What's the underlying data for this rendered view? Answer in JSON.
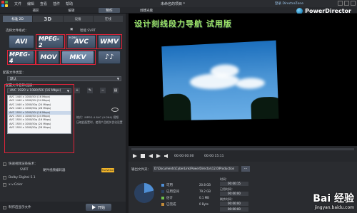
{
  "titlebar": {
    "menus": [
      "文件",
      "编辑",
      "查看",
      "插件",
      "帮助"
    ],
    "document_title": "未命名的项目 *",
    "login": "登录 DirectorZone"
  },
  "modebar": {
    "tabs": [
      "捕获",
      "编辑",
      "制作"
    ],
    "active_tab": "制作",
    "create_disc": "创建光盘",
    "brand": "PowerDirector"
  },
  "left_panel": {
    "sub_tabs": [
      "标准 2D",
      "3D",
      "设备",
      "在线"
    ],
    "format_section_label": "选择文件格式：",
    "smart_svrt_label": "智能 SVRT",
    "formats": [
      {
        "label": "AVI"
      },
      {
        "label": "MPEG-2"
      },
      {
        "label": "AVC",
        "sub": "H.264"
      },
      {
        "label": "WMV"
      },
      {
        "label": "MPEG-4"
      },
      {
        "label": "MOV"
      },
      {
        "label": "MKV",
        "selected": true
      },
      {
        "label": "♪♪"
      }
    ],
    "settings_label": "配置文件类型：",
    "type_value": "默认",
    "profile_label": "配置文件名称/品质：",
    "profile_value": "AVC 1920 x 1080/50i (16 Mbps)",
    "profile_options": [
      "AVC 1440 x 1080/50i (16 Mbps)",
      "AVC 1440 x 1080/50i (24 Mbps)",
      "AVC 1440 x 1080/50p (24 Mbps)",
      "AVC 1440 x 1080/50p (28 Mbps)",
      "AVC 1920 x 1080/50i (16 Mbps)",
      "AVC 1920 x 1080/50i (24 Mbps)",
      "AVC 1920 x 1080/50p (16 Mbps)",
      "AVC 1920 x 1080/50p (24 Mbps)",
      "AVC 1920 x 1080/50p (28 Mbps)"
    ],
    "info_lines": [
      "格式：MPEG-4 AVC (H.264) 视频",
      "压缩此配置时，使用产品相关优化设置"
    ],
    "fast_render": "快速视频渲染技术：",
    "svrt_opt": "SVRT",
    "hw_opt": "硬件视频编码器",
    "dolby": "Dolby Digital 5.1",
    "xvcolor": "x.v.Color",
    "badge": "TrueVelocity",
    "bottom_check": "制作后显示文件",
    "start": "开始"
  },
  "preview": {
    "overlay": "设计刻线段力导航 试用版"
  },
  "transport": {
    "timecode_1": "00:00:00:00",
    "timecode_2": "00:00:15:11"
  },
  "output": {
    "folder_label": "输出文件夹：",
    "path": "D:\\Documents\\CyberLink\\PowerDirector\\12.0\\Production",
    "browse": "...",
    "legend": [
      {
        "label": "可用",
        "value": "20.8 GB",
        "color": "#4f8fd6"
      },
      {
        "label": "已用空间",
        "value": "79.2 GB",
        "color": "#2a4060"
      },
      {
        "label": "估计",
        "value": "0.1 MB",
        "color": "#6ec04a"
      },
      {
        "label": "已完成",
        "value": "0 Byte",
        "color": "#c08a3a"
      }
    ],
    "stats": [
      {
        "label": "时间：",
        "value": "00:00:15"
      },
      {
        "label": "已用时间：",
        "value": "00:00:00"
      },
      {
        "label": "剩余时间：",
        "value": "00:00:00"
      },
      {
        "label": "",
        "value": "00:00:00"
      }
    ],
    "watermark_main": "Bai 经验",
    "watermark_sub": "jingyan.baidu.com"
  },
  "colors": {
    "accent": "#566273",
    "highlight_red": "#e0243a",
    "overlay_text": "#9ae066"
  }
}
